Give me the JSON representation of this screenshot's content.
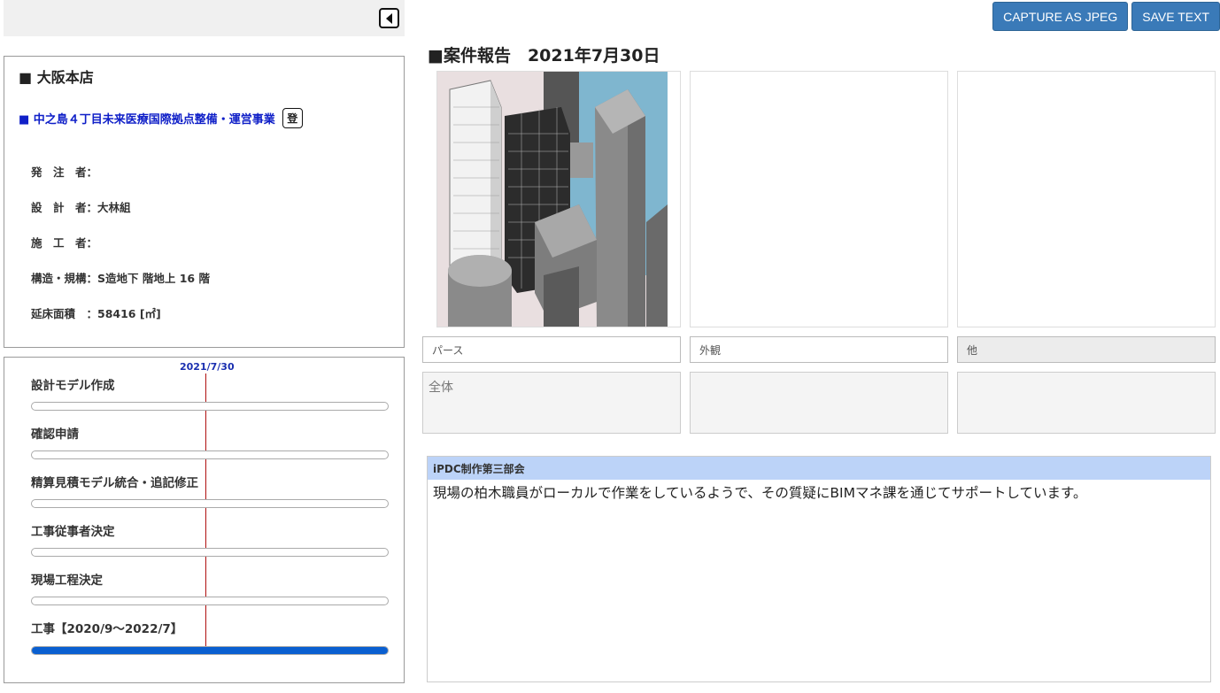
{
  "left": {
    "branch_title": "■ 大阪本店",
    "project_title": "■ 中之島４丁目未来医療国際拠点整備・運営事業",
    "register_label": "登",
    "info": [
      "発　注　者：",
      "設　計　者：大林組",
      "施　工　者：",
      "構造・規構：S造地下 階地上 16 階",
      "延床面積　：58416 [㎡]"
    ]
  },
  "progress": {
    "today_label": "2021/7/30",
    "tasks": [
      {
        "label": "設計モデル作成",
        "fill": 0
      },
      {
        "label": "確認申請",
        "fill": 0
      },
      {
        "label": "精算見積モデル統合・追記修正",
        "fill": 0
      },
      {
        "label": "工事従事者決定",
        "fill": 0
      },
      {
        "label": "現場工程決定",
        "fill": 0
      },
      {
        "label": "工事【2020/9～2022/7】",
        "fill": 1.0
      }
    ]
  },
  "actions": {
    "capture_label": "CAPTURE AS JPEG",
    "save_label": "SAVE TEXT"
  },
  "report": {
    "title": "■案件報告　2021年7月30日",
    "captions": [
      "パース",
      "外観",
      "他"
    ],
    "notes": [
      "全体",
      "",
      ""
    ],
    "comment_header": "iPDC制作第三部会",
    "comment_body": "現場の柏木職員がローカルで作業をしているようで、その質疑にBIMマネ課を通じてサポートしています。"
  },
  "colors": {
    "accent_button": "#3a7ab8",
    "progress_fill": "#0a5fd0",
    "today_line": "#b01010",
    "comment_header_bg": "#bcd3f8",
    "project_link": "#1020c8"
  }
}
